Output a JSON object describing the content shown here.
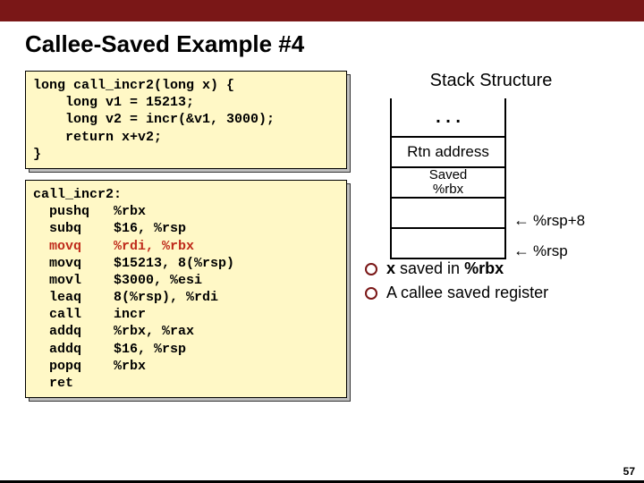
{
  "title": "Callee-Saved Example #4",
  "stack_title": "Stack Structure",
  "code_c": "long call_incr2(long x) {\n    long v1 = 15213;\n    long v2 = incr(&v1, 3000);\n    return x+v2;\n}",
  "asm_label": "call_incr2:",
  "asm": [
    {
      "op": "pushq",
      "arg": "%rbx",
      "red": false
    },
    {
      "op": "subq",
      "arg": "$16, %rsp",
      "red": false
    },
    {
      "op": "movq",
      "arg": "%rdi, %rbx",
      "red": true
    },
    {
      "op": "movq",
      "arg": "$15213, 8(%rsp)",
      "red": false
    },
    {
      "op": "movl",
      "arg": "$3000, %esi",
      "red": false
    },
    {
      "op": "leaq",
      "arg": "8(%rsp), %rdi",
      "red": false
    },
    {
      "op": "call",
      "arg": "incr",
      "red": false
    },
    {
      "op": "addq",
      "arg": "%rbx, %rax",
      "red": false
    },
    {
      "op": "addq",
      "arg": "$16, %rsp",
      "red": false
    },
    {
      "op": "popq",
      "arg": "%rbx",
      "red": false
    },
    {
      "op": "ret",
      "arg": "",
      "red": false
    }
  ],
  "stack": {
    "dots": ". . .",
    "rtn": "Rtn address",
    "saved1": "Saved",
    "saved2": "%rbx"
  },
  "labels": {
    "rsp8": "%rsp+8",
    "rsp": "%rsp"
  },
  "bullets": [
    {
      "pre": "",
      "b": "x",
      "mid": " saved in ",
      "b2": "%rbx",
      "post": ""
    },
    {
      "pre": "A callee saved register",
      "b": "",
      "mid": "",
      "b2": "",
      "post": ""
    }
  ],
  "page": "57"
}
